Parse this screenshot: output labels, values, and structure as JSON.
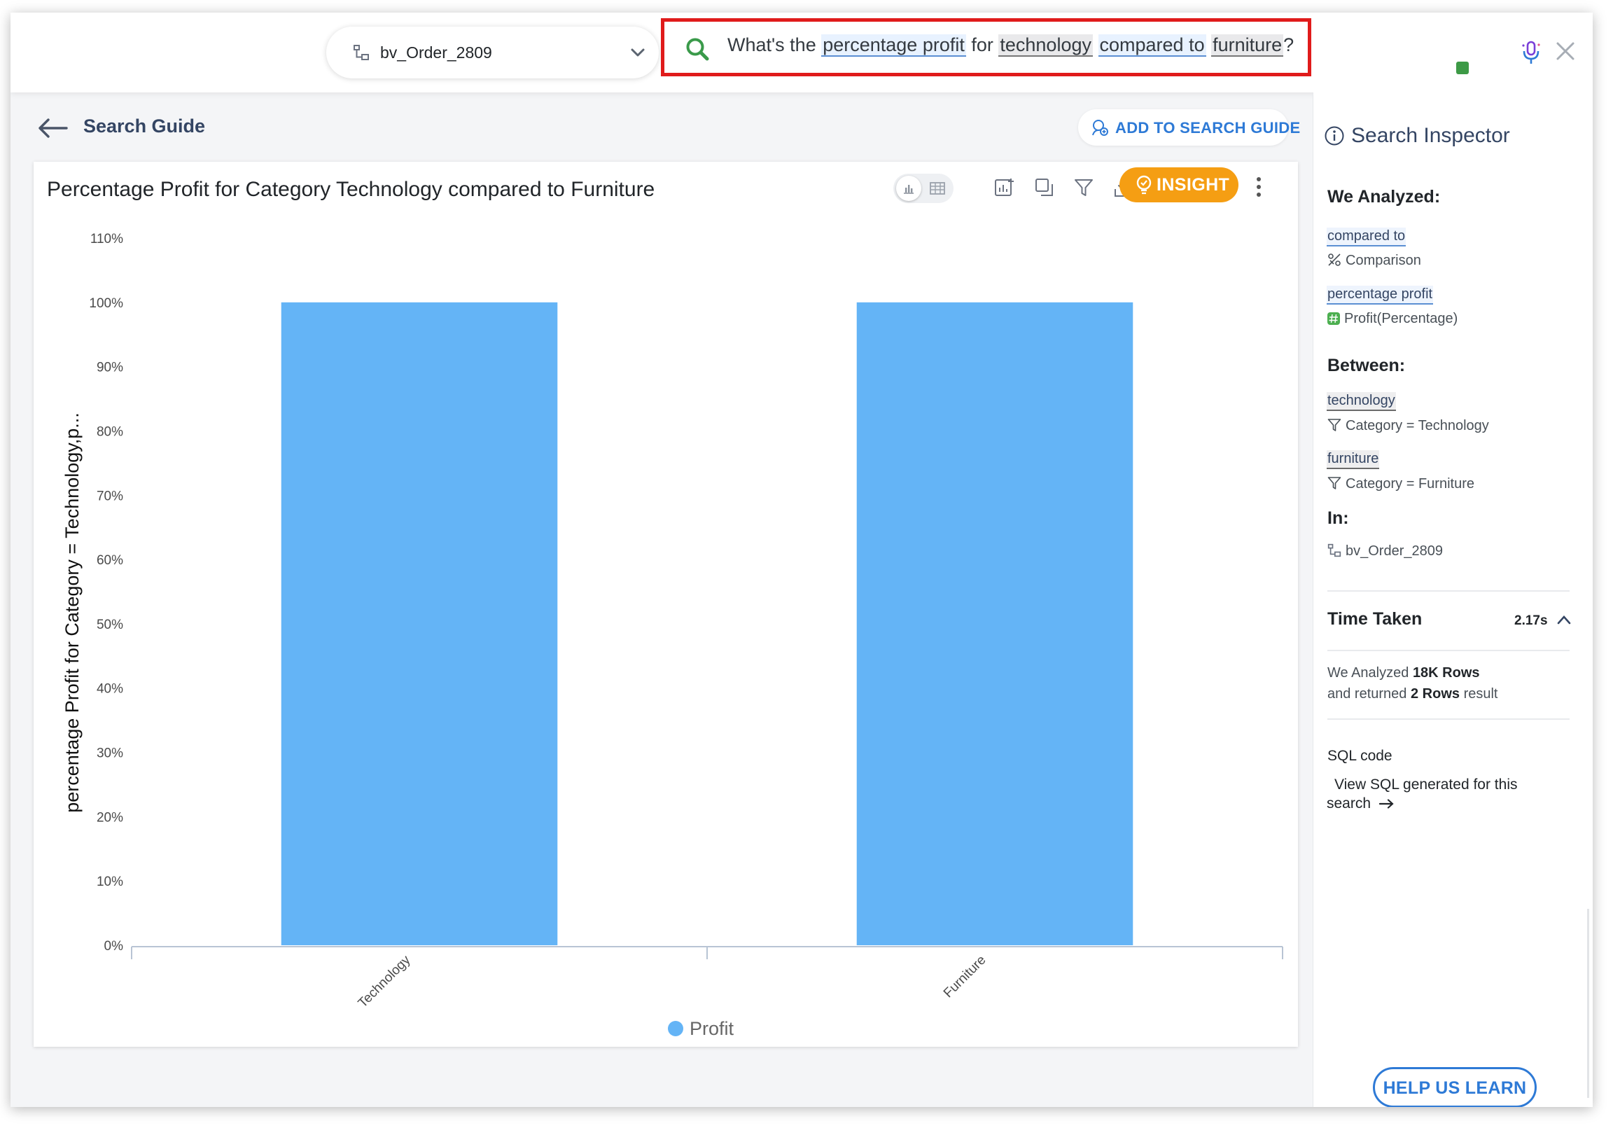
{
  "datasource": {
    "name": "bv_Order_2809",
    "icon": "datasource-icon"
  },
  "query": {
    "tokens": [
      {
        "text": "What's the ",
        "style": "plain"
      },
      {
        "text": "percentage profit",
        "style": "blue"
      },
      {
        "text": " for ",
        "style": "plain"
      },
      {
        "text": "technology",
        "style": "gray"
      },
      {
        "text": " ",
        "style": "plain"
      },
      {
        "text": "compared to",
        "style": "blue"
      },
      {
        "text": " ",
        "style": "plain"
      },
      {
        "text": "furniture",
        "style": "gray"
      },
      {
        "text": "?",
        "style": "plain"
      }
    ]
  },
  "nav": {
    "back_label": "Search Guide",
    "add_to_guide": "ADD TO SEARCH GUIDE"
  },
  "toolbar": {
    "insight_label": "INSIGHT"
  },
  "colors": {
    "bar": "#64b4f6",
    "accent": "#2e7ad6",
    "insight": "#f59e13",
    "highlight_border": "#e01b1b"
  },
  "chart_data": {
    "type": "bar",
    "title": "Percentage Profit for Category Technology compared to Furniture",
    "ylabel": "percentage Profit for Category = Technology,p...",
    "xlabel": "",
    "categories": [
      "Technology",
      "Furniture"
    ],
    "series": [
      {
        "name": "Profit",
        "values": [
          100,
          100
        ]
      }
    ],
    "ylim": [
      0,
      110
    ],
    "yticks": [
      "0%",
      "10%",
      "20%",
      "30%",
      "40%",
      "50%",
      "60%",
      "70%",
      "80%",
      "90%",
      "100%",
      "110%"
    ],
    "legend": "bottom-center",
    "grid": false
  },
  "inspector": {
    "title": "Search Inspector",
    "analyzed_heading": "We Analyzed:",
    "analyzed": [
      {
        "term": "compared to",
        "detail": "Comparison",
        "icon": "percent-compare-icon"
      },
      {
        "term": "percentage profit",
        "detail": "Profit(Percentage)",
        "icon": "measure-hash-icon"
      }
    ],
    "between_heading": "Between:",
    "between": [
      {
        "term": "technology",
        "detail": "Category = Technology",
        "icon": "filter-icon"
      },
      {
        "term": "furniture",
        "detail": "Category = Furniture",
        "icon": "filter-icon"
      }
    ],
    "in_heading": "In:",
    "in_source": "bv_Order_2809",
    "time_taken_label": "Time Taken",
    "time_taken_value": "2.17s",
    "rows_analyzed_prefix": "We Analyzed ",
    "rows_analyzed_value": "18K Rows",
    "rows_returned_prefix": "and returned ",
    "rows_returned_value": "2 Rows",
    "rows_returned_suffix": " result",
    "sql_label": "SQL code",
    "sql_link_line1": "View SQL generated for this",
    "sql_link_line2": "search",
    "help_label": "HELP US LEARN"
  }
}
